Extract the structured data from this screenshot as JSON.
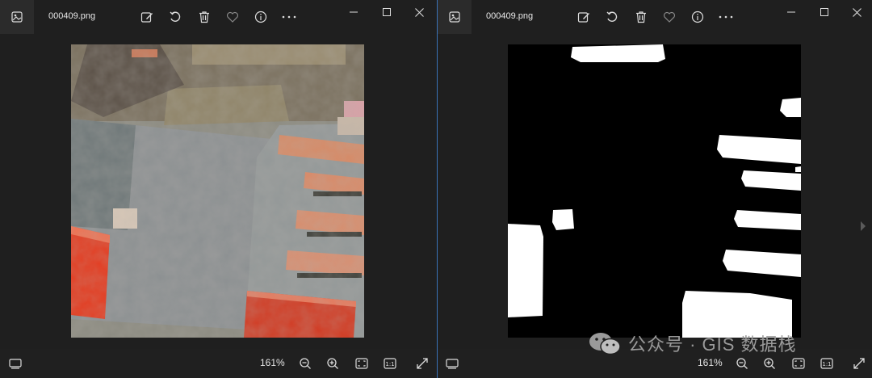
{
  "left_window": {
    "file_name": "000409.png",
    "zoom": "161%",
    "icons": [
      "image-app-icon",
      "edit-icon",
      "rotate-icon",
      "delete-icon",
      "favorite-icon",
      "info-icon",
      "more-icon",
      "minimize-icon",
      "maximize-icon",
      "close-icon",
      "filmstrip-icon",
      "zoom-out-icon",
      "zoom-in-icon",
      "fit-to-window-icon",
      "actual-size-icon",
      "fullscreen-icon"
    ],
    "actual_size_label": "1:1"
  },
  "right_window": {
    "file_name": "000409.png",
    "zoom": "161%",
    "icons": [
      "image-app-icon",
      "edit-icon",
      "rotate-icon",
      "delete-icon",
      "favorite-icon",
      "info-icon",
      "more-icon",
      "minimize-icon",
      "maximize-icon",
      "close-icon",
      "filmstrip-icon",
      "zoom-out-icon",
      "zoom-in-icon",
      "fit-to-window-icon",
      "actual-size-icon",
      "fullscreen-icon",
      "next-image-icon"
    ],
    "actual_size_label": "1:1"
  },
  "watermark": {
    "text": "公众号 · GIS 数据栈",
    "icon": "wechat-icon"
  },
  "colors": {
    "background": "#1f1f1f",
    "active_border": "#3a73b8",
    "mask_white": "#ffffff",
    "mask_black": "#000000",
    "roof_orange": "#d98a6a",
    "roof_red": "#e23b1e"
  }
}
